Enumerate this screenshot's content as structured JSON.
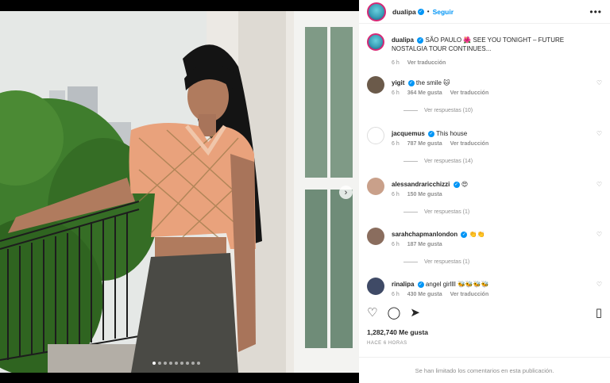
{
  "post": {
    "author": "dualipa",
    "follow_label": "Seguir",
    "more_label": "•••",
    "caption": "SÃO PAULO 🌺 SEE YOU TONIGHT – FUTURE NOSTALGIA TOUR CONTINUES...",
    "caption_time": "6 h",
    "caption_translation": "Ver traducción",
    "likes": "1,282,740 Me gusta",
    "timestamp": "HACE 6 HORAS",
    "comments_limited": "Se han limitado los comentarios en esta publicación.",
    "carousel_dots": 9,
    "carousel_active": 0
  },
  "comments": [
    {
      "user": "yigit",
      "verified": true,
      "text": "the smile 🐱",
      "time": "6 h",
      "likes": "364 Me gusta",
      "translate": "Ver traducción",
      "replies": "Ver respuestas (10)",
      "avatar_color": "#6b5a4a"
    },
    {
      "user": "jacquemus",
      "verified": true,
      "text": "This house",
      "time": "6 h",
      "likes": "787 Me gusta",
      "translate": "Ver traducción",
      "replies": "Ver respuestas (14)",
      "avatar_color": "#ffffff"
    },
    {
      "user": "alessandraricchizzi",
      "verified": true,
      "text": "😍",
      "time": "6 h",
      "likes": "150 Me gusta",
      "translate": "",
      "replies": "Ver respuestas (1)",
      "avatar_color": "#c9a08a"
    },
    {
      "user": "sarahchapmanlondon",
      "verified": true,
      "text": "👏👏",
      "time": "6 h",
      "likes": "187 Me gusta",
      "translate": "",
      "replies": "Ver respuestas (1)",
      "avatar_color": "#8a6d5e"
    },
    {
      "user": "rinalipa",
      "verified": true,
      "text": "angel girllll 🐝🐝🐝🐝",
      "time": "6 h",
      "likes": "430 Me gusta",
      "translate": "Ver traducción",
      "replies": "",
      "avatar_color": "#3f4a66"
    }
  ],
  "icons": {
    "like": "heart-icon",
    "comment": "comment-icon",
    "share": "share-icon",
    "save": "bookmark-icon",
    "next": "chevron-right-icon",
    "comment_like": "heart-icon"
  },
  "colors": {
    "verified": "#0095f6",
    "link": "#0095f6",
    "muted": "#8e8e8e"
  }
}
